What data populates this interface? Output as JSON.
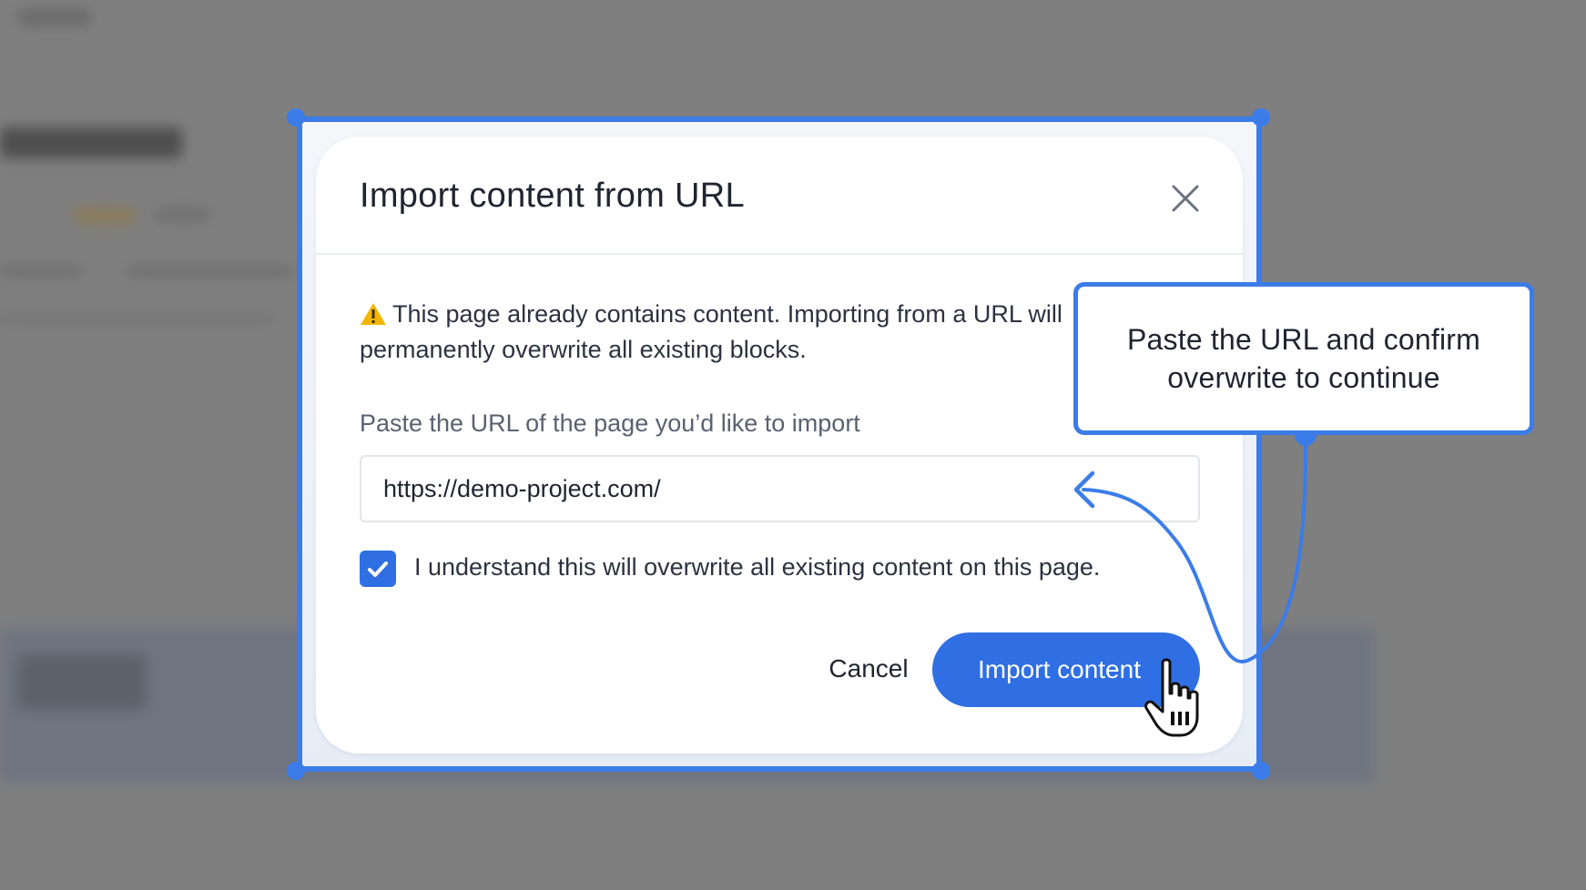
{
  "modal": {
    "title": "Import content from URL",
    "warning_text": "This page already contains content. Importing from a URL will permanently overwrite all existing blocks.",
    "url_label": "Paste the URL of the page you’d like to import",
    "url_value": "https://demo-project.com/",
    "checkbox_checked": true,
    "checkbox_label": "I understand this will overwrite all existing content on this page.",
    "cancel_label": "Cancel",
    "import_label": "Import content"
  },
  "tooltip": {
    "text": "Paste the URL and confirm overwrite to continue"
  },
  "colors": {
    "accent": "#2f6fe3",
    "frame": "#3b7ce8",
    "warning": "#f2b705",
    "overlay": "#7f7f7f"
  },
  "icons": {
    "close": "close-icon",
    "warning": "warning-icon",
    "check": "check-icon",
    "cursor": "hand-pointer-icon"
  }
}
